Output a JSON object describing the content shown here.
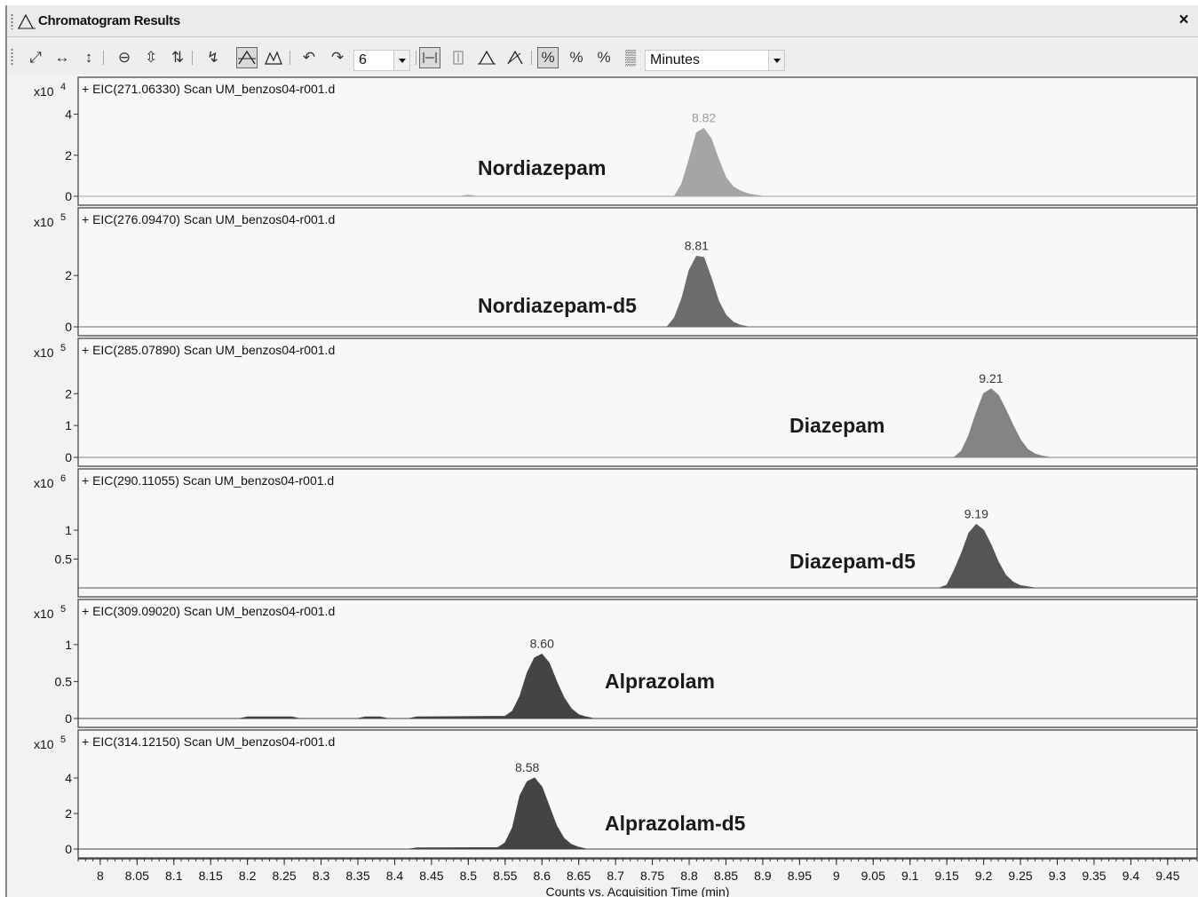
{
  "window": {
    "title": "Chromatogram Results",
    "close_label": "×"
  },
  "toolbar": {
    "tools": [
      "autoscale-icon",
      "zoom-x-icon",
      "zoom-y-icon",
      "zoom-out-icon",
      "fit-y-icon",
      "fit-xy-icon",
      "pick-peak-icon",
      "integrate-icon",
      "peak-shape-icon",
      "undo-icon",
      "redo-icon",
      "overlay-icon",
      "ms-spectrum-icon",
      "peak-label-icon",
      "peak-label-alt-icon",
      "normalize-icon",
      "percent-icon",
      "percent-ratio-icon",
      "match-icon"
    ],
    "count_value": "6",
    "units_value": "Minutes"
  },
  "chart_data": {
    "type": "area",
    "x_axis": {
      "xlabel": "Counts vs. Acquisition Time (min)",
      "xlim": [
        7.97,
        9.49
      ],
      "ticks": [
        8,
        8.05,
        8.1,
        8.15,
        8.2,
        8.25,
        8.3,
        8.35,
        8.4,
        8.45,
        8.5,
        8.55,
        8.6,
        8.65,
        8.7,
        8.75,
        8.8,
        8.85,
        8.9,
        8.95,
        9,
        9.05,
        9.1,
        9.15,
        9.2,
        9.25,
        9.3,
        9.35,
        9.4,
        9.45
      ],
      "tick_labels": [
        "8",
        "8.05",
        "8.1",
        "8.15",
        "8.2",
        "8.25",
        "8.3",
        "8.35",
        "8.4",
        "8.45",
        "8.5",
        "8.55",
        "8.6",
        "8.65",
        "8.7",
        "8.75",
        "8.8",
        "8.85",
        "8.9",
        "8.95",
        "9",
        "9.05",
        "9.1",
        "9.15",
        "9.2",
        "9.25",
        "9.3",
        "9.35",
        "9.4",
        "9.45"
      ]
    },
    "panels": [
      {
        "title": "+ EIC(271.06330) Scan UM_benzos04-r001.d",
        "scale_label": "x10",
        "exponent": "4",
        "compound": "Nordiazepam",
        "peak_rt": 8.82,
        "peak_label": "8.82",
        "ylim": [
          0,
          4.5
        ],
        "yticks": [
          0,
          2,
          4
        ],
        "ytick_labels": [
          "0",
          "2",
          "4"
        ],
        "color": "#a5a5a5",
        "x": [
          7.97,
          8.49,
          8.5,
          8.51,
          8.78,
          8.79,
          8.8,
          8.81,
          8.82,
          8.83,
          8.84,
          8.85,
          8.86,
          8.87,
          8.88,
          8.89,
          8.9,
          9.49
        ],
        "y": [
          0,
          0,
          0.05,
          0,
          0,
          0.6,
          1.8,
          3.1,
          3.3,
          2.8,
          1.8,
          0.9,
          0.45,
          0.25,
          0.12,
          0.05,
          0,
          0
        ]
      },
      {
        "title": "+ EIC(276.09470) Scan UM_benzos04-r001.d",
        "scale_label": "x10",
        "exponent": "5",
        "compound": "Nordiazepam-d5",
        "peak_rt": 8.81,
        "peak_label": "8.81",
        "ylim": [
          0,
          3.6
        ],
        "yticks": [
          0,
          2
        ],
        "ytick_labels": [
          "0",
          "2"
        ],
        "color": "#6c6c6c",
        "x": [
          7.97,
          8.77,
          8.78,
          8.79,
          8.8,
          8.81,
          8.82,
          8.83,
          8.84,
          8.85,
          8.86,
          8.87,
          8.88,
          9.49
        ],
        "y": [
          0,
          0,
          0.35,
          1.1,
          2.2,
          2.75,
          2.7,
          1.9,
          1.0,
          0.45,
          0.18,
          0.06,
          0,
          0
        ]
      },
      {
        "title": "+ EIC(285.07890) Scan UM_benzos04-r001.d",
        "scale_label": "x10",
        "exponent": "5",
        "compound": "Diazepam",
        "peak_rt": 9.21,
        "peak_label": "9.21",
        "ylim": [
          0,
          2.9
        ],
        "yticks": [
          0,
          1,
          2
        ],
        "ytick_labels": [
          "0",
          "1",
          "2"
        ],
        "color": "#848484",
        "x": [
          7.97,
          9.16,
          9.17,
          9.18,
          9.19,
          9.2,
          9.21,
          9.22,
          9.23,
          9.24,
          9.25,
          9.26,
          9.27,
          9.28,
          9.29,
          9.49
        ],
        "y": [
          0,
          0,
          0.2,
          0.7,
          1.4,
          2.0,
          2.15,
          1.95,
          1.5,
          1.0,
          0.55,
          0.25,
          0.1,
          0.04,
          0,
          0
        ]
      },
      {
        "title": "+ EIC(290.11055) Scan UM_benzos04-r001.d",
        "scale_label": "x10",
        "exponent": "6",
        "compound": "Diazepam-d5",
        "peak_rt": 9.19,
        "peak_label": "9.19",
        "ylim": [
          0,
          1.6
        ],
        "yticks": [
          0.5,
          1
        ],
        "ytick_labels": [
          "0.5",
          "1"
        ],
        "color": "#555555",
        "x": [
          7.97,
          9.14,
          9.15,
          9.16,
          9.17,
          9.18,
          9.19,
          9.2,
          9.21,
          9.22,
          9.23,
          9.24,
          9.25,
          9.26,
          9.27,
          9.49
        ],
        "y": [
          0,
          0,
          0.05,
          0.3,
          0.6,
          0.95,
          1.1,
          1.0,
          0.75,
          0.45,
          0.22,
          0.1,
          0.04,
          0.02,
          0,
          0
        ]
      },
      {
        "title": "+ EIC(309.09020) Scan UM_benzos04-r001.d",
        "scale_label": "x10",
        "exponent": "5",
        "compound": "Alprazolam",
        "peak_rt": 8.6,
        "peak_label": "8.60",
        "ylim": [
          0,
          1.25
        ],
        "yticks": [
          0,
          0.5,
          1
        ],
        "ytick_labels": [
          "0",
          "0.5",
          "1"
        ],
        "color": "#444444",
        "x": [
          7.97,
          8.19,
          8.2,
          8.26,
          8.27,
          8.35,
          8.36,
          8.38,
          8.39,
          8.42,
          8.43,
          8.55,
          8.56,
          8.57,
          8.58,
          8.59,
          8.6,
          8.61,
          8.62,
          8.63,
          8.64,
          8.65,
          8.66,
          8.67,
          9.49
        ],
        "y": [
          0,
          0,
          0.02,
          0.02,
          0,
          0,
          0.02,
          0.02,
          0,
          0,
          0.02,
          0.03,
          0.1,
          0.3,
          0.62,
          0.82,
          0.87,
          0.75,
          0.5,
          0.28,
          0.13,
          0.05,
          0.02,
          0,
          0
        ]
      },
      {
        "title": "+ EIC(314.12150) Scan UM_benzos04-r001.d",
        "scale_label": "x10",
        "exponent": "5",
        "compound": "Alprazolam-d5",
        "peak_rt": 8.58,
        "peak_label": "8.58",
        "ylim": [
          0,
          5.2
        ],
        "yticks": [
          0,
          2,
          4
        ],
        "ytick_labels": [
          "0",
          "2",
          "4"
        ],
        "color": "#444444",
        "x": [
          7.97,
          8.42,
          8.43,
          8.54,
          8.55,
          8.56,
          8.57,
          8.58,
          8.59,
          8.6,
          8.61,
          8.62,
          8.63,
          8.64,
          8.65,
          8.66,
          9.49
        ],
        "y": [
          0,
          0,
          0.06,
          0.08,
          0.35,
          1.2,
          3.0,
          3.8,
          4.0,
          3.5,
          2.4,
          1.3,
          0.6,
          0.25,
          0.1,
          0,
          0
        ]
      }
    ]
  }
}
